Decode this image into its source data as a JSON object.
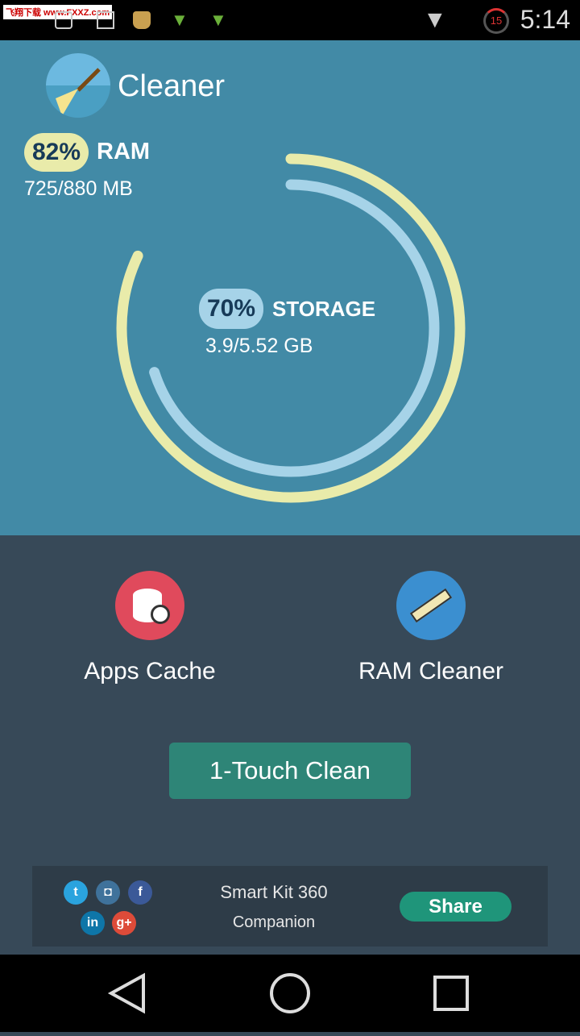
{
  "status_bar": {
    "watermark": "飞翔下载 www.FXXZ.com",
    "time": "5:14",
    "badge": "15"
  },
  "app": {
    "title": "Cleaner",
    "logo_icon": "broom-icon"
  },
  "ram": {
    "percent_label": "82%",
    "percent": 82,
    "label": "RAM",
    "value": "725/880 MB",
    "color": "#e9ebaa"
  },
  "storage": {
    "percent_label": "70%",
    "percent": 70,
    "label": "STORAGE",
    "value": "3.9/5.52 GB",
    "color": "#a6d3e8"
  },
  "features": [
    {
      "label": "Apps Cache",
      "icon": "database-clock-icon",
      "color": "#e04a5c"
    },
    {
      "label": "RAM Cleaner",
      "icon": "memory-chip-icon",
      "color": "#3b8fd0"
    }
  ],
  "clean_button": "1-Touch Clean",
  "banner": {
    "line1": "Smart Kit 360",
    "line2": "Companion",
    "share": "Share",
    "social": [
      {
        "name": "twitter",
        "glyph": "t"
      },
      {
        "name": "instagram",
        "glyph": "◘"
      },
      {
        "name": "facebook",
        "glyph": "f"
      },
      {
        "name": "linkedin",
        "glyph": "in"
      },
      {
        "name": "google-plus",
        "glyph": "g+"
      }
    ]
  },
  "nav": {
    "back": "back-icon",
    "home": "home-icon",
    "recents": "recents-icon"
  }
}
